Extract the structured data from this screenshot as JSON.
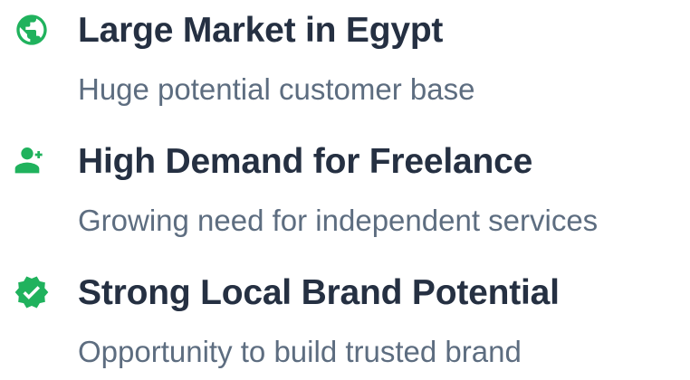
{
  "accent_color": "#20b25d",
  "features": [
    {
      "icon": "globe-icon",
      "title": "Large Market in Egypt",
      "description": "Huge potential customer base"
    },
    {
      "icon": "add-person-icon",
      "title": "High Demand for Freelance",
      "description": "Growing need for independent services"
    },
    {
      "icon": "verified-badge-icon",
      "title": "Strong Local Brand Potential",
      "description": "Opportunity to build trusted brand"
    }
  ]
}
